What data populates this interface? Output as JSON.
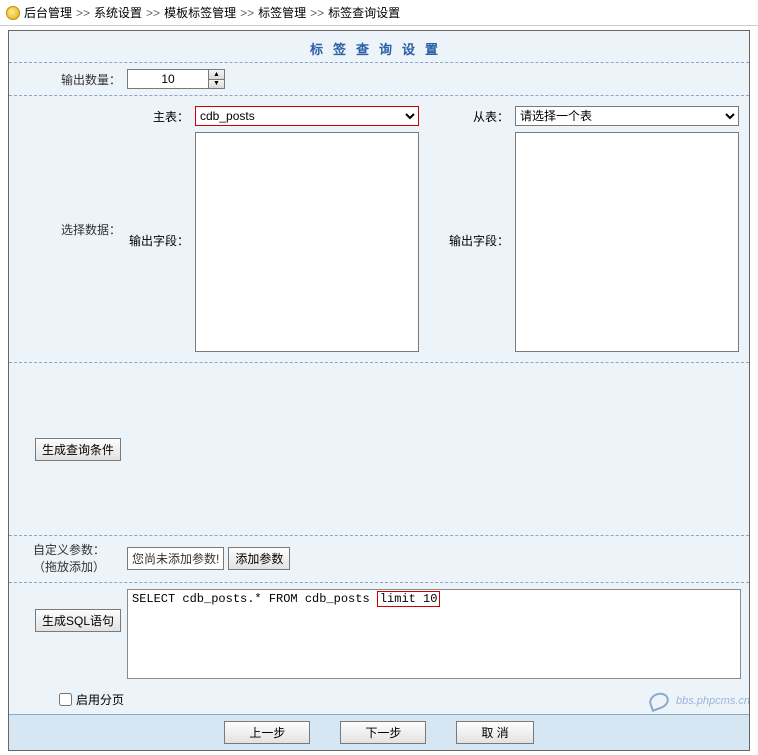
{
  "breadcrumb": {
    "items": [
      "后台管理",
      "系统设置",
      "模板标签管理",
      "标签管理",
      "标签查询设置"
    ],
    "separator": ">>"
  },
  "panel": {
    "title": "标签查询设置"
  },
  "output_count": {
    "label": "输出数量：",
    "value": "10"
  },
  "data_select": {
    "section_label": "选择数据：",
    "main_table": {
      "label": "主表：",
      "value": "cdb_posts",
      "field_label": "输出字段："
    },
    "sub_table": {
      "label": "从表：",
      "placeholder": "请选择一个表",
      "field_label": "输出字段："
    }
  },
  "query_cond": {
    "button": "生成查询条件"
  },
  "custom_params": {
    "label_line1": "自定义参数：",
    "label_line2": "（拖放添加）",
    "hint": "您尚未添加参数!",
    "add_button": "添加参数"
  },
  "sql": {
    "button": "生成SQL语句",
    "text_prefix": "SELECT cdb_posts.* FROM cdb_posts ",
    "text_highlight": "limit 10"
  },
  "paging": {
    "label": "启用分页"
  },
  "footer": {
    "prev": "上一步",
    "next": "下一步",
    "cancel": "取 消"
  },
  "watermark": {
    "text": "bbs.phpcms.cn"
  }
}
